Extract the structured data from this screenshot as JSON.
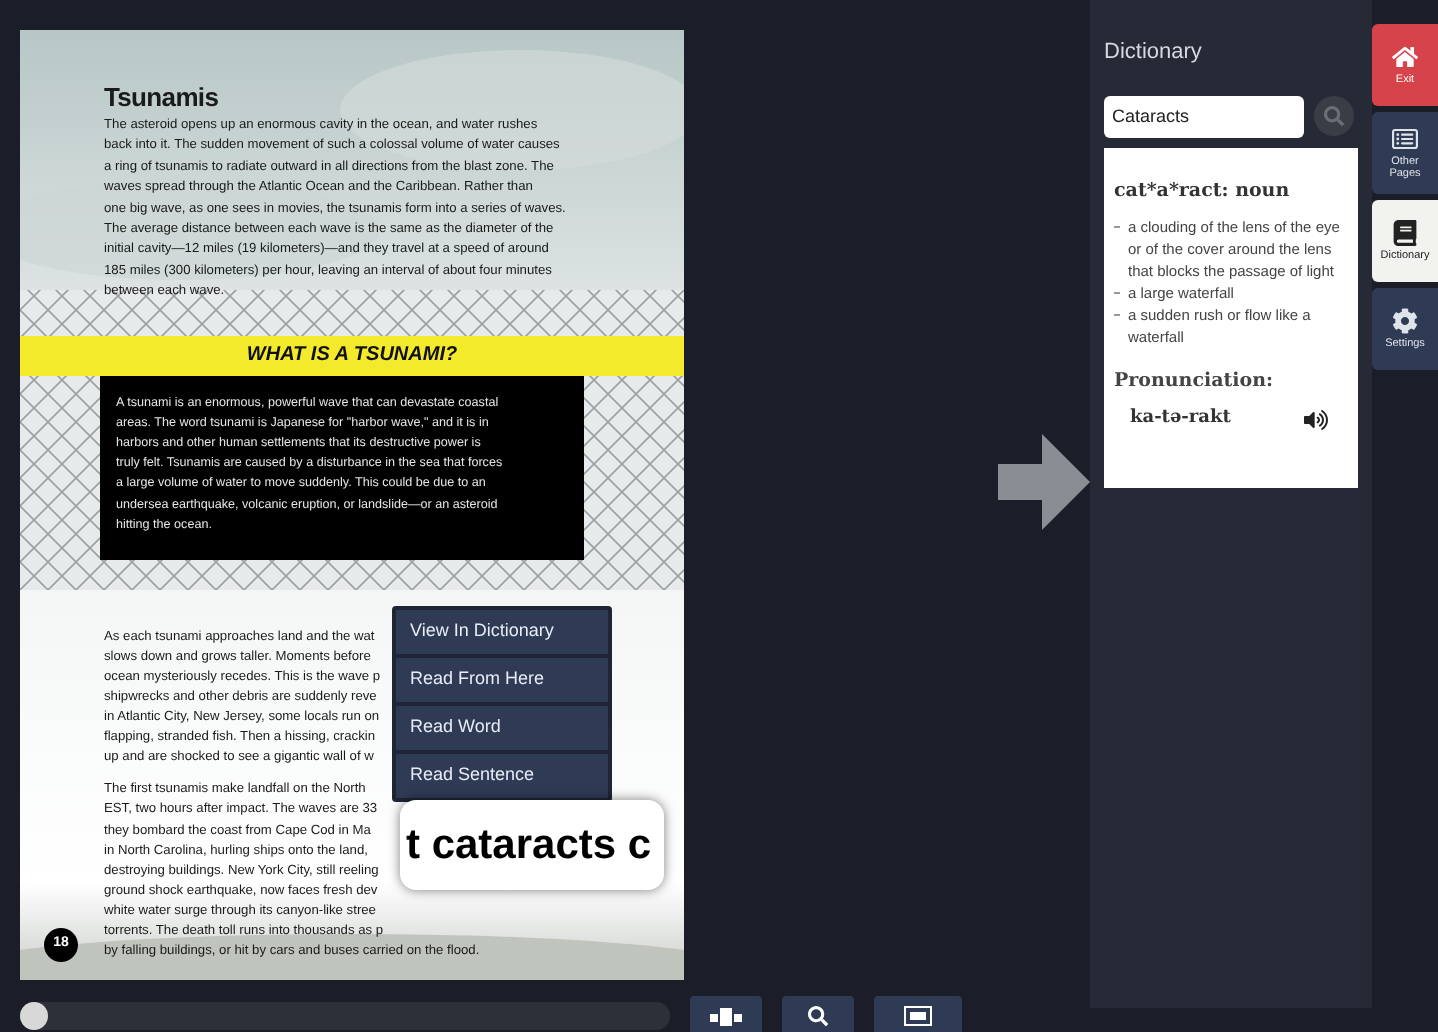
{
  "page": {
    "title": "Tsunamis",
    "intro": [
      "The asteroid opens up an enormous cavity in the ocean, and water rushes",
      "back into it. The sudden movement of such a colossal volume of water causes",
      "a ring of tsunamis to radiate outward in all directions from the blast zone. The",
      "waves spread through the Atlantic Ocean and the Caribbean. Rather than",
      "one big wave, as one sees in movies, the tsunamis form into a series of waves.",
      "The average distance between each wave is the same as the diameter of the",
      "initial cavity—12 miles (19 kilometers)—and they travel at a speed of around",
      "185 miles (300 kilometers) per hour, leaving an interval of about four minutes",
      "between each wave."
    ],
    "banner": "WHAT IS A TSUNAMI?",
    "box": [
      "A tsunami is an enormous, powerful wave that can devastate coastal",
      "areas. The word tsunami is Japanese for \"harbor wave,\" and it is in",
      "harbors and other human settlements that its destructive power is",
      "truly felt. Tsunamis are caused by a disturbance in the sea that forces",
      "a large volume of water to move suddenly. This could be due to an",
      "undersea earthquake, volcanic eruption, or landslide—or an asteroid",
      "hitting the ocean."
    ],
    "paragraphs": [
      [
        "As each tsunami approaches land and the wat",
        "slows down and grows taller. Moments before",
        "ocean mysteriously recedes. This is the wave p",
        "shipwrecks and other debris are suddenly reve",
        "in Atlantic City, New Jersey, some locals run on",
        "flapping, stranded fish. Then a hissing, crackin",
        "up and are shocked to see a gigantic wall of w"
      ],
      [
        "The first tsunamis make landfall on the North",
        "EST, two hours after impact. The waves are 33",
        "they bombard the coast from Cape Cod in Ma",
        "in North Carolina, hurling ships onto the land,",
        "destroying buildings. New York City, still reeling",
        "ground shock earthquake, now faces fresh dev",
        "white water surge through its canyon-like stree",
        "torrents. The death toll runs into thousands as p",
        "by falling buildings, or hit by cars and buses carried on the flood."
      ]
    ],
    "page_number": "18"
  },
  "context_menu": [
    "View In Dictionary",
    "Read From Here",
    "Read Word",
    "Read Sentence"
  ],
  "magnifier": "t cataracts c",
  "dictionary": {
    "title": "Dictionary",
    "search_value": "Cataracts",
    "headword": "cat*a*ract: noun",
    "definitions": [
      "a clouding of the lens of the eye or of the cover around the lens that blocks the passage of light",
      "a large waterfall",
      "a sudden rush or flow like a waterfall"
    ],
    "pronunciation_label": "Pronunciation:",
    "pronunciation": "ka-tə-rakt"
  },
  "nav": [
    {
      "kind": "home",
      "label": "Exit",
      "selected": false
    },
    {
      "kind": "pages",
      "label": "Other Pages",
      "selected": false
    },
    {
      "kind": "dictionary",
      "label": "Dictionary",
      "selected": true
    },
    {
      "kind": "settings",
      "label": "Settings",
      "selected": false
    }
  ],
  "player": {
    "level": 0.0
  }
}
